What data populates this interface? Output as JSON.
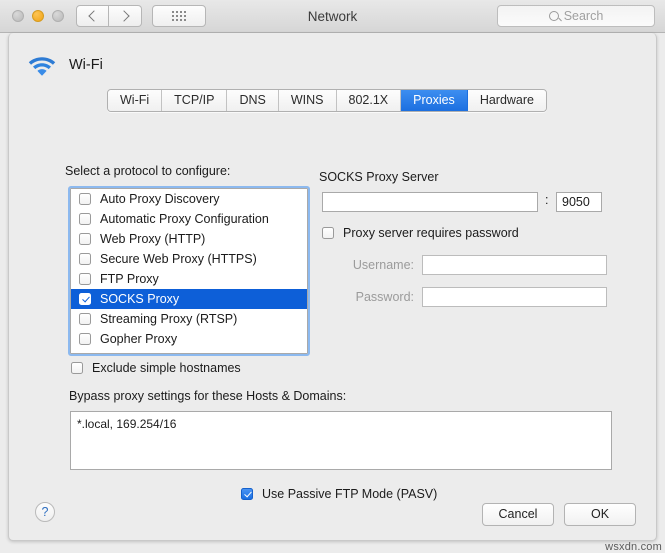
{
  "window": {
    "title": "Network",
    "traffic_lights": [
      "close",
      "minimize",
      "zoom"
    ],
    "search": {
      "placeholder": "Search",
      "icon": "search-icon"
    },
    "nav": {
      "back": "back-icon",
      "forward": "forward-icon",
      "grid": "show-all-icon"
    }
  },
  "service": {
    "icon": "wifi-icon",
    "name": "Wi-Fi"
  },
  "tabs": [
    {
      "label": "Wi-Fi",
      "active": false
    },
    {
      "label": "TCP/IP",
      "active": false
    },
    {
      "label": "DNS",
      "active": false
    },
    {
      "label": "WINS",
      "active": false
    },
    {
      "label": "802.1X",
      "active": false
    },
    {
      "label": "Proxies",
      "active": true
    },
    {
      "label": "Hardware",
      "active": false
    }
  ],
  "left": {
    "select_label": "Select a protocol to configure:",
    "protocols": [
      {
        "label": "Auto Proxy Discovery",
        "checked": false,
        "selected": false
      },
      {
        "label": "Automatic Proxy Configuration",
        "checked": false,
        "selected": false
      },
      {
        "label": "Web Proxy (HTTP)",
        "checked": false,
        "selected": false
      },
      {
        "label": "Secure Web Proxy (HTTPS)",
        "checked": false,
        "selected": false
      },
      {
        "label": "FTP Proxy",
        "checked": false,
        "selected": false
      },
      {
        "label": "SOCKS Proxy",
        "checked": true,
        "selected": true
      },
      {
        "label": "Streaming Proxy (RTSP)",
        "checked": false,
        "selected": false
      },
      {
        "label": "Gopher Proxy",
        "checked": false,
        "selected": false
      }
    ],
    "exclude_simple_hostnames": {
      "label": "Exclude simple hostnames",
      "checked": false
    },
    "bypass_label": "Bypass proxy settings for these Hosts & Domains:",
    "bypass_value": "*.local, 169.254/16"
  },
  "right": {
    "socks_title": "SOCKS Proxy Server",
    "host_value": "",
    "separator": ":",
    "port_value": "9050",
    "requires_password": {
      "label": "Proxy server requires password",
      "checked": false
    },
    "username_label": "Username:",
    "username_value": "",
    "password_label": "Password:",
    "password_value": ""
  },
  "passive_ftp": {
    "label": "Use Passive FTP Mode (PASV)",
    "checked": true
  },
  "footer": {
    "help_label": "?",
    "cancel_label": "Cancel",
    "ok_label": "OK"
  },
  "watermark": "wsxdn.com",
  "colors": {
    "accent_blue": "#0d5fd8",
    "tab_blue": "#2a7fe8",
    "focus_ring": "#8cb9ef",
    "window_bg": "#ececec"
  }
}
